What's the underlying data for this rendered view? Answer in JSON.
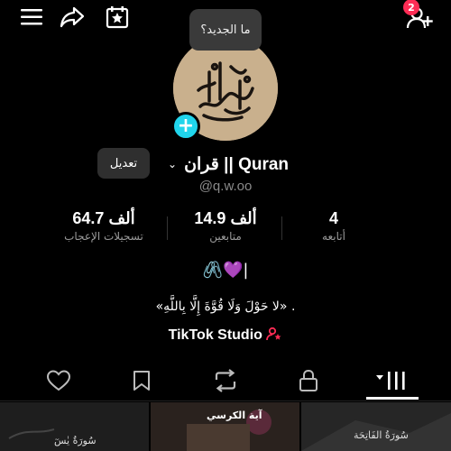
{
  "header": {
    "notification_count": "2",
    "whats_new": "ما الجديد؟",
    "icons": [
      "menu-icon",
      "share-icon",
      "calendar-star-icon",
      "add-friend-icon"
    ]
  },
  "profile": {
    "edit_label": "تعديل",
    "name": "قران || Quran",
    "handle": "@q.w.oo"
  },
  "stats": {
    "likes": {
      "value": "64.7 ألف",
      "label": "تسجيلات الإعجاب"
    },
    "followers": {
      "value": "14.9 ألف",
      "label": "متابعين"
    },
    "following": {
      "value": "4",
      "label": "أتابعه"
    }
  },
  "bio": {
    "icons": "🖇️💜|",
    "quote": "«لا حَوْلَ وَلَا قُوَّةَ إِلَّا بِاللَّهِ» .",
    "studio_link": "TikTok Studio"
  },
  "tabs": [
    "videos-grid-icon",
    "lock-icon",
    "repost-icon",
    "bookmark-icon",
    "heart-icon"
  ],
  "thumbnails": [
    {
      "label": "سُورَةُ يٰسٓ"
    },
    {
      "label": "آية الكرسي"
    },
    {
      "label": "سُورَةُ الفَاتِحَة"
    }
  ],
  "colors": {
    "accent": "#20d5ec",
    "badge": "#fe2c55",
    "background": "#000000"
  }
}
